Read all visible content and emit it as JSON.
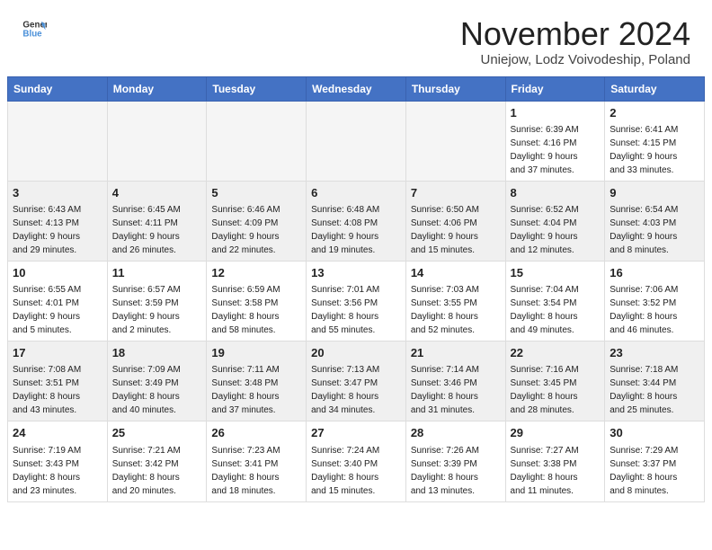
{
  "header": {
    "logo_general": "General",
    "logo_blue": "Blue",
    "month_title": "November 2024",
    "subtitle": "Uniejow, Lodz Voivodeship, Poland"
  },
  "weekdays": [
    "Sunday",
    "Monday",
    "Tuesday",
    "Wednesday",
    "Thursday",
    "Friday",
    "Saturday"
  ],
  "weeks": [
    [
      {
        "day": "",
        "info": "",
        "empty": true
      },
      {
        "day": "",
        "info": "",
        "empty": true
      },
      {
        "day": "",
        "info": "",
        "empty": true
      },
      {
        "day": "",
        "info": "",
        "empty": true
      },
      {
        "day": "",
        "info": "",
        "empty": true
      },
      {
        "day": "1",
        "info": "Sunrise: 6:39 AM\nSunset: 4:16 PM\nDaylight: 9 hours\nand 37 minutes."
      },
      {
        "day": "2",
        "info": "Sunrise: 6:41 AM\nSunset: 4:15 PM\nDaylight: 9 hours\nand 33 minutes."
      }
    ],
    [
      {
        "day": "3",
        "info": "Sunrise: 6:43 AM\nSunset: 4:13 PM\nDaylight: 9 hours\nand 29 minutes."
      },
      {
        "day": "4",
        "info": "Sunrise: 6:45 AM\nSunset: 4:11 PM\nDaylight: 9 hours\nand 26 minutes."
      },
      {
        "day": "5",
        "info": "Sunrise: 6:46 AM\nSunset: 4:09 PM\nDaylight: 9 hours\nand 22 minutes."
      },
      {
        "day": "6",
        "info": "Sunrise: 6:48 AM\nSunset: 4:08 PM\nDaylight: 9 hours\nand 19 minutes."
      },
      {
        "day": "7",
        "info": "Sunrise: 6:50 AM\nSunset: 4:06 PM\nDaylight: 9 hours\nand 15 minutes."
      },
      {
        "day": "8",
        "info": "Sunrise: 6:52 AM\nSunset: 4:04 PM\nDaylight: 9 hours\nand 12 minutes."
      },
      {
        "day": "9",
        "info": "Sunrise: 6:54 AM\nSunset: 4:03 PM\nDaylight: 9 hours\nand 8 minutes."
      }
    ],
    [
      {
        "day": "10",
        "info": "Sunrise: 6:55 AM\nSunset: 4:01 PM\nDaylight: 9 hours\nand 5 minutes."
      },
      {
        "day": "11",
        "info": "Sunrise: 6:57 AM\nSunset: 3:59 PM\nDaylight: 9 hours\nand 2 minutes."
      },
      {
        "day": "12",
        "info": "Sunrise: 6:59 AM\nSunset: 3:58 PM\nDaylight: 8 hours\nand 58 minutes."
      },
      {
        "day": "13",
        "info": "Sunrise: 7:01 AM\nSunset: 3:56 PM\nDaylight: 8 hours\nand 55 minutes."
      },
      {
        "day": "14",
        "info": "Sunrise: 7:03 AM\nSunset: 3:55 PM\nDaylight: 8 hours\nand 52 minutes."
      },
      {
        "day": "15",
        "info": "Sunrise: 7:04 AM\nSunset: 3:54 PM\nDaylight: 8 hours\nand 49 minutes."
      },
      {
        "day": "16",
        "info": "Sunrise: 7:06 AM\nSunset: 3:52 PM\nDaylight: 8 hours\nand 46 minutes."
      }
    ],
    [
      {
        "day": "17",
        "info": "Sunrise: 7:08 AM\nSunset: 3:51 PM\nDaylight: 8 hours\nand 43 minutes."
      },
      {
        "day": "18",
        "info": "Sunrise: 7:09 AM\nSunset: 3:49 PM\nDaylight: 8 hours\nand 40 minutes."
      },
      {
        "day": "19",
        "info": "Sunrise: 7:11 AM\nSunset: 3:48 PM\nDaylight: 8 hours\nand 37 minutes."
      },
      {
        "day": "20",
        "info": "Sunrise: 7:13 AM\nSunset: 3:47 PM\nDaylight: 8 hours\nand 34 minutes."
      },
      {
        "day": "21",
        "info": "Sunrise: 7:14 AM\nSunset: 3:46 PM\nDaylight: 8 hours\nand 31 minutes."
      },
      {
        "day": "22",
        "info": "Sunrise: 7:16 AM\nSunset: 3:45 PM\nDaylight: 8 hours\nand 28 minutes."
      },
      {
        "day": "23",
        "info": "Sunrise: 7:18 AM\nSunset: 3:44 PM\nDaylight: 8 hours\nand 25 minutes."
      }
    ],
    [
      {
        "day": "24",
        "info": "Sunrise: 7:19 AM\nSunset: 3:43 PM\nDaylight: 8 hours\nand 23 minutes."
      },
      {
        "day": "25",
        "info": "Sunrise: 7:21 AM\nSunset: 3:42 PM\nDaylight: 8 hours\nand 20 minutes."
      },
      {
        "day": "26",
        "info": "Sunrise: 7:23 AM\nSunset: 3:41 PM\nDaylight: 8 hours\nand 18 minutes."
      },
      {
        "day": "27",
        "info": "Sunrise: 7:24 AM\nSunset: 3:40 PM\nDaylight: 8 hours\nand 15 minutes."
      },
      {
        "day": "28",
        "info": "Sunrise: 7:26 AM\nSunset: 3:39 PM\nDaylight: 8 hours\nand 13 minutes."
      },
      {
        "day": "29",
        "info": "Sunrise: 7:27 AM\nSunset: 3:38 PM\nDaylight: 8 hours\nand 11 minutes."
      },
      {
        "day": "30",
        "info": "Sunrise: 7:29 AM\nSunset: 3:37 PM\nDaylight: 8 hours\nand 8 minutes."
      }
    ]
  ]
}
